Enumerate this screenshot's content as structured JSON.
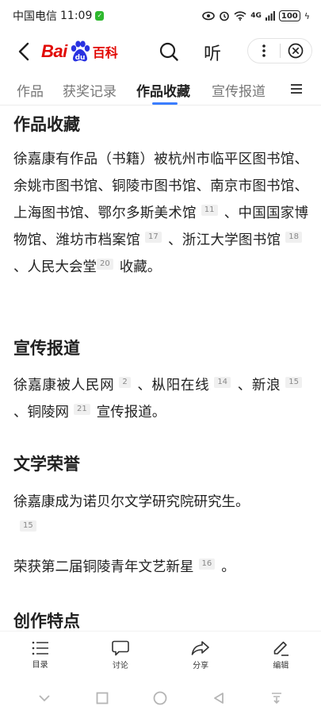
{
  "status_bar": {
    "carrier": "中国电信",
    "time": "11:09",
    "network": "4G",
    "battery": "100"
  },
  "nav": {
    "logo_bai": "Bai",
    "logo_baike": "百科",
    "listen_label": "听"
  },
  "tabs": [
    {
      "label": "作品"
    },
    {
      "label": "获奖记录"
    },
    {
      "label": "作品收藏"
    },
    {
      "label": "宣传报道"
    }
  ],
  "sections": {
    "collection": {
      "title": "作品收藏",
      "p1": "徐嘉康有作品（书籍）被杭州市临平区图书馆、余姚市图书馆、铜陵市图书馆、南京市图书馆、上海图书馆、鄂尔多斯美术馆",
      "r1": "11",
      "p2": "、中国国家博物馆、潍坊市档案馆",
      "r2": "17",
      "p3": "、浙江大学图书馆",
      "r3": "18",
      "p4": "、人民大会堂",
      "r4": "20",
      "p5": "收藏。"
    },
    "press": {
      "title": "宣传报道",
      "p1": "徐嘉康被人民网",
      "r1": "2",
      "p2": "、枞阳在线",
      "r2": "14",
      "p3": "、新浪",
      "r3": "15",
      "p4": "、铜陵网",
      "r4": "21",
      "p5": "宣传报道。"
    },
    "honors": {
      "title": "文学荣誉",
      "para1": "徐嘉康成为诺贝尔文学研究院研究生。",
      "para1_ref": "15",
      "para2": "荣获第二届铜陵青年文艺新星",
      "para2_ref": "16",
      "para2_end": "。"
    },
    "features": {
      "title": "创作特点"
    }
  },
  "toolbar": {
    "toc": "目录",
    "discuss": "讨论",
    "share": "分享",
    "edit": "编辑"
  }
}
